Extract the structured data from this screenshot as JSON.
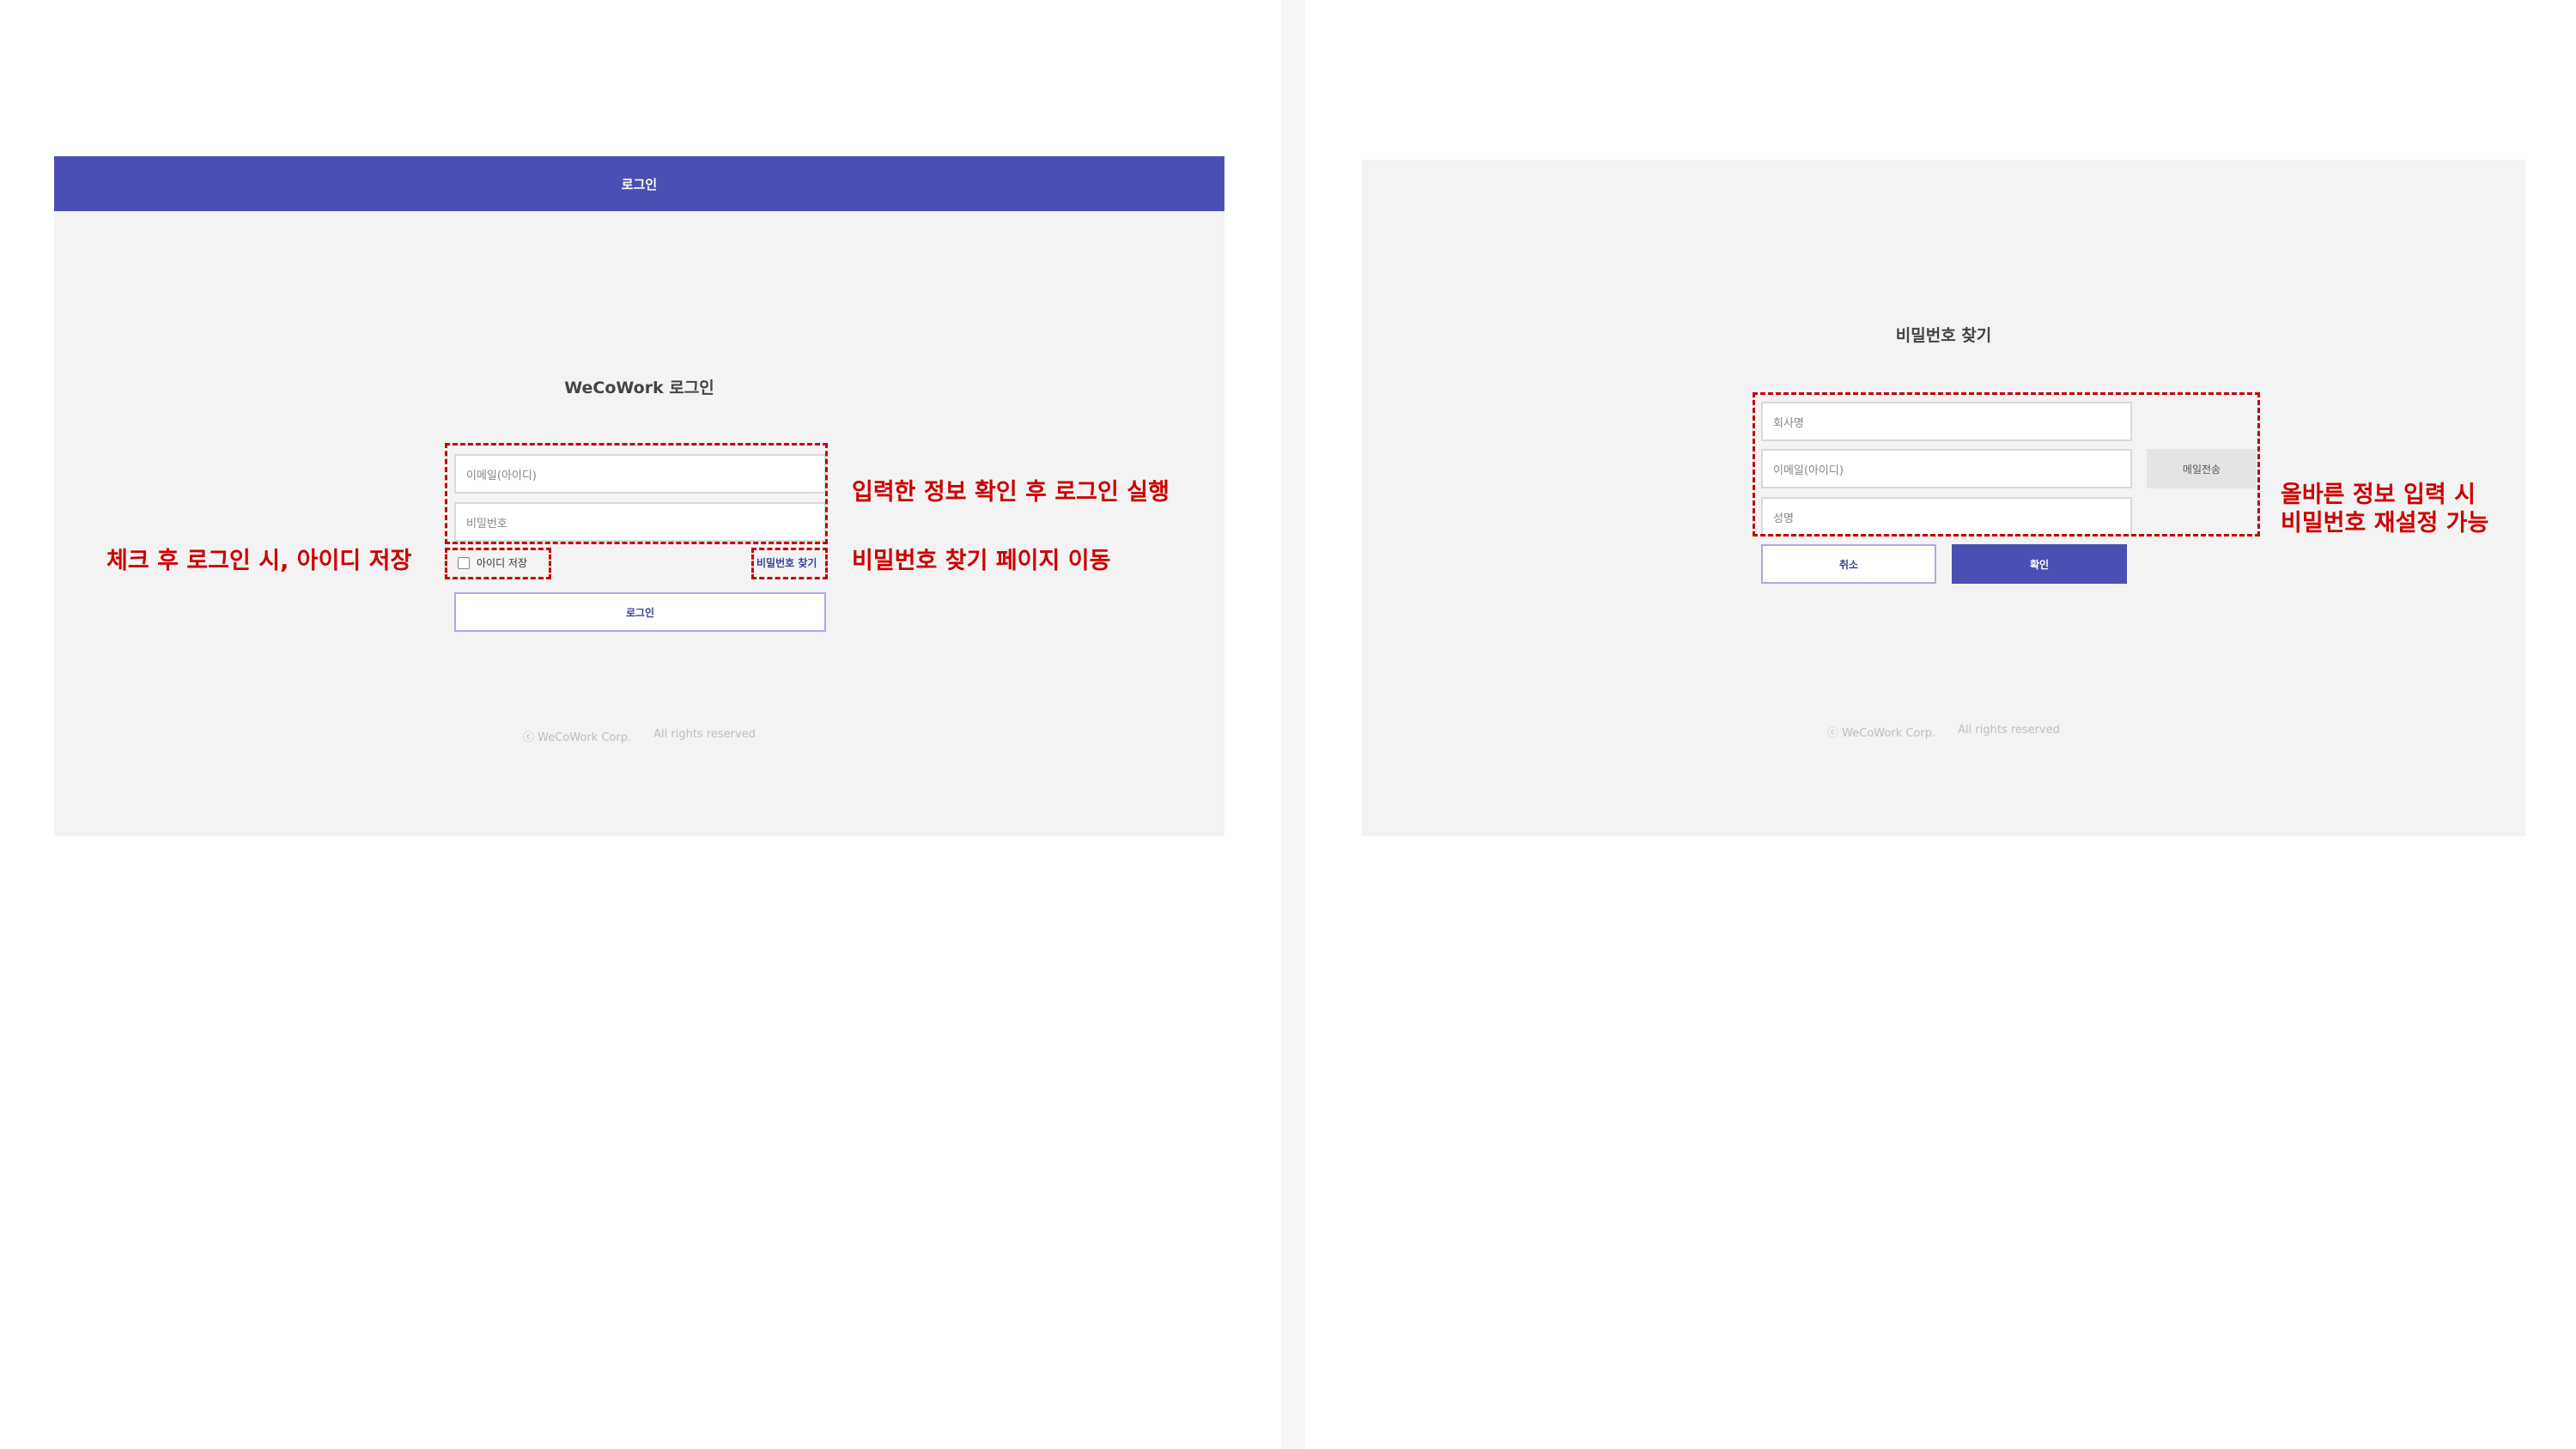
{
  "login": {
    "header_title": "로그인",
    "title": "WeCoWork 로그인",
    "email_placeholder": "이메일(아이디)",
    "password_placeholder": "비밀번호",
    "remember_label": "아이디 저장",
    "find_password_link": "비밀번호 찾기",
    "login_button": "로그인",
    "footer_company": "ⓒ WeCoWork Corp.",
    "footer_rights": "All rights reserved"
  },
  "find_password": {
    "title": "비밀번호 찾기",
    "company_placeholder": "회사명",
    "email_placeholder": "이메일(아이디)",
    "send_email_button": "메일전송",
    "name_placeholder": "성명",
    "cancel_button": "취소",
    "confirm_button": "확인",
    "footer_company": "ⓒ WeCoWork Corp.",
    "footer_rights": "All rights reserved"
  },
  "annotations": {
    "login_info": "입력한 정보 확인 후 로그인 실행",
    "remember_id": "체크 후 로그인 시, 아이디 저장",
    "find_page": "비밀번호 찾기 페이지 이동",
    "reset_line1": "올바른 정보 입력 시",
    "reset_line2": "비밀번호 재설정 가능"
  },
  "colors": {
    "brand": "#4b4fb3",
    "panel_background": "#f3f3f3",
    "annotation": "#cc0000"
  }
}
